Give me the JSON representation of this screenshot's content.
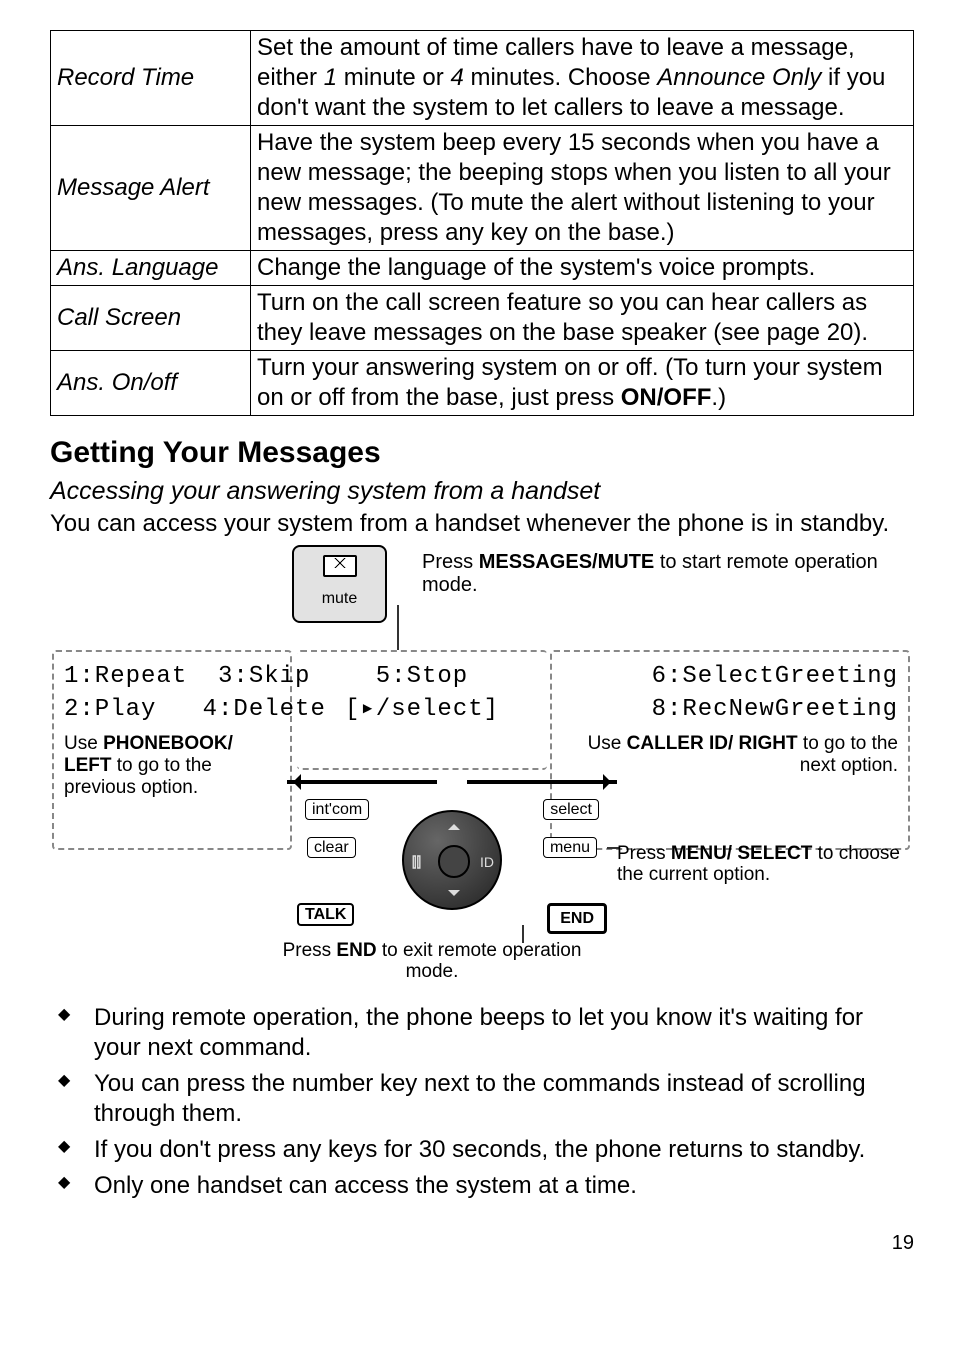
{
  "table": {
    "rows": [
      {
        "label": "Record Time",
        "desc_html": "Set the amount of time callers have to leave a message, either <i>1</i> minute or <i>4</i> minutes. Choose <i>Announce Only</i> if you don't want the system to let callers to leave a message."
      },
      {
        "label": "Message Alert",
        "desc_html": "Have the system beep every 15 seconds when you have a new message; the beeping stops when you listen to all your new messages. (To mute the alert without listening to your messages, press any key on the base.)"
      },
      {
        "label": "Ans. Language",
        "desc_html": "Change the language of the system's voice prompts."
      },
      {
        "label": "Call Screen",
        "desc_html": "Turn on the call screen feature so you can hear callers as they leave messages on the base speaker (see page 20)."
      },
      {
        "label": "Ans. On/off",
        "desc_html": "Turn your answering system on or off. (To turn your system on or off from the base, just press <b>ON/OFF</b>.)"
      }
    ]
  },
  "section_title": "Getting Your Messages",
  "subhead": "Accessing your answering system from a handset",
  "intro": "You can access your system from a handset whenever the phone is in standby.",
  "diagram": {
    "top_note_pre": "Press ",
    "top_note_bold": "MESSAGES/MUTE",
    "top_note_post": " to start remote operation mode.",
    "mute_label": "mute",
    "lcd_left_line1": "1:Repeat  3:Skip",
    "lcd_left_line2": "2:Play   4:Delete",
    "left_note_pre": "Use ",
    "left_note_bold": "PHONEBOOK/ LEFT",
    "left_note_post": " to go to the previous option.",
    "lcd_mid_line1": "5:Stop",
    "lcd_mid_line2": "[▸/select]",
    "lcd_right_line1": "6:SelectGreeting",
    "lcd_right_line2": "8:RecNewGreeting",
    "right_note_pre": "Use ",
    "right_note_bold": "CALLER ID/ RIGHT",
    "right_note_post": " to go to the next option.",
    "menu_note_pre": "Press ",
    "menu_note_bold": "MENU/ SELECT",
    "menu_note_post": " to choose the current option.",
    "end_note_pre": "Press ",
    "end_note_bold": "END",
    "end_note_post": " to exit remote operation mode.",
    "tag_intcom": "int'com",
    "tag_select": "select",
    "tag_clear": "clear",
    "tag_menu": "menu",
    "tag_talk": "TALK",
    "tag_end": "END",
    "glyph_left": "⫿⫿",
    "glyph_right": "ID"
  },
  "bullets": [
    "During remote operation, the phone beeps to let you know it's waiting for your next command.",
    "You can press the number key next to the commands instead of scrolling through them.",
    "If you don't press any keys for 30 seconds, the phone returns to standby.",
    "Only one handset can access the system at a time."
  ],
  "page_number": "19"
}
